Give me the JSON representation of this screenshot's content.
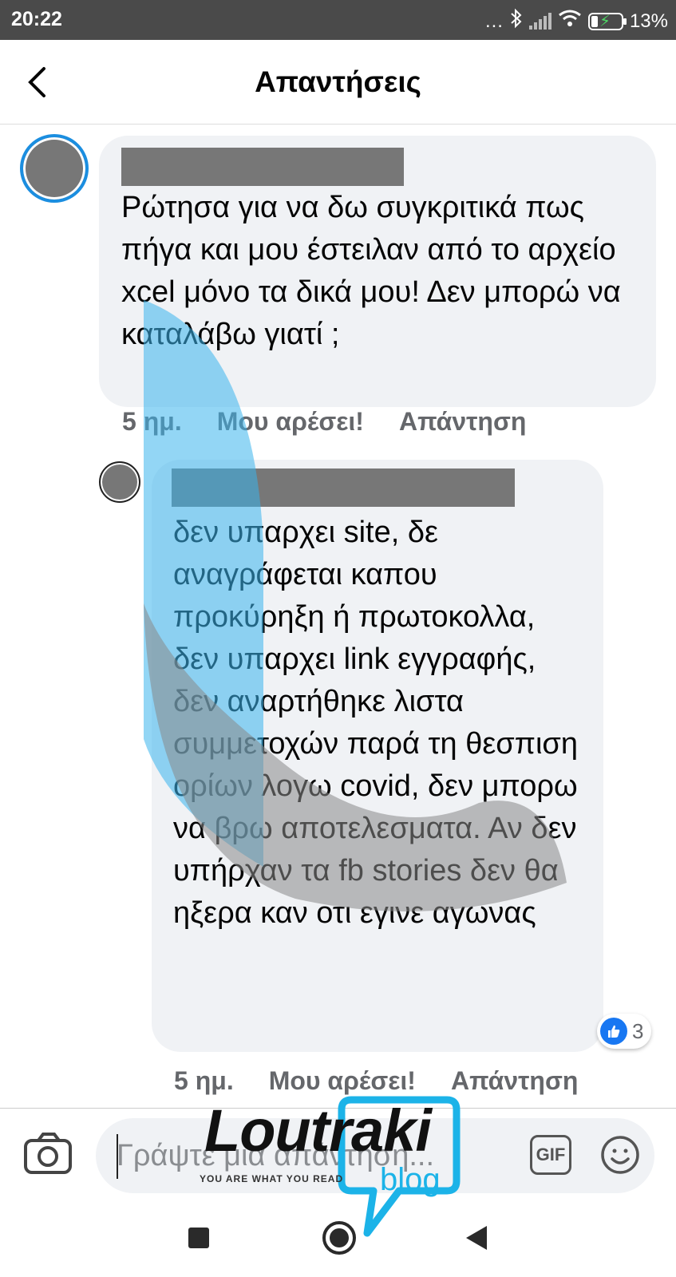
{
  "status_bar": {
    "time": "20:22",
    "dots": "...",
    "battery": "13%"
  },
  "header": {
    "title": "Απαντήσεις"
  },
  "comment": {
    "text": "Ρώτησα για να δω συγκριτικά πως πήγα και μου έστειλαν από το αρχείο  xcel μόνο τα δικά μου! Δεν μπορώ να καταλάβω γιατί ;",
    "time": "5 ημ.",
    "like_label": "Μου αρέσει!",
    "reply_label": "Απάντηση"
  },
  "reply": {
    "text": "δεν υπαρχει site, δε αναγράφεται καπου προκύρηξη ή πρωτοκολλα, δεν υπαρχει link εγγραφής, δεν αναρτήθηκε λιστα συμμετοχών παρά τη θεσπιση ορίων λογω covid, δεν μπορω να βρω αποτελεσματα. Αν δεν υπήρχαν τα fb stories δεν θα ηξερα καν οτι εγινε αγωνας",
    "time": "5 ημ.",
    "like_label": "Μου αρέσει!",
    "reply_label": "Απάντηση",
    "reaction_count": "3"
  },
  "composer": {
    "placeholder": "Γράψτε μια απάντηση...",
    "gif_label": "GIF"
  },
  "watermark": {
    "brand": "Loutraki",
    "tagline": "YOU ARE WHAT YOU READ",
    "sub": "blog"
  },
  "colors": {
    "accent": "#1877f2",
    "bubble": "#f0f2f5",
    "meta_text": "#65676b",
    "status_bar": "#4a4a4a"
  }
}
